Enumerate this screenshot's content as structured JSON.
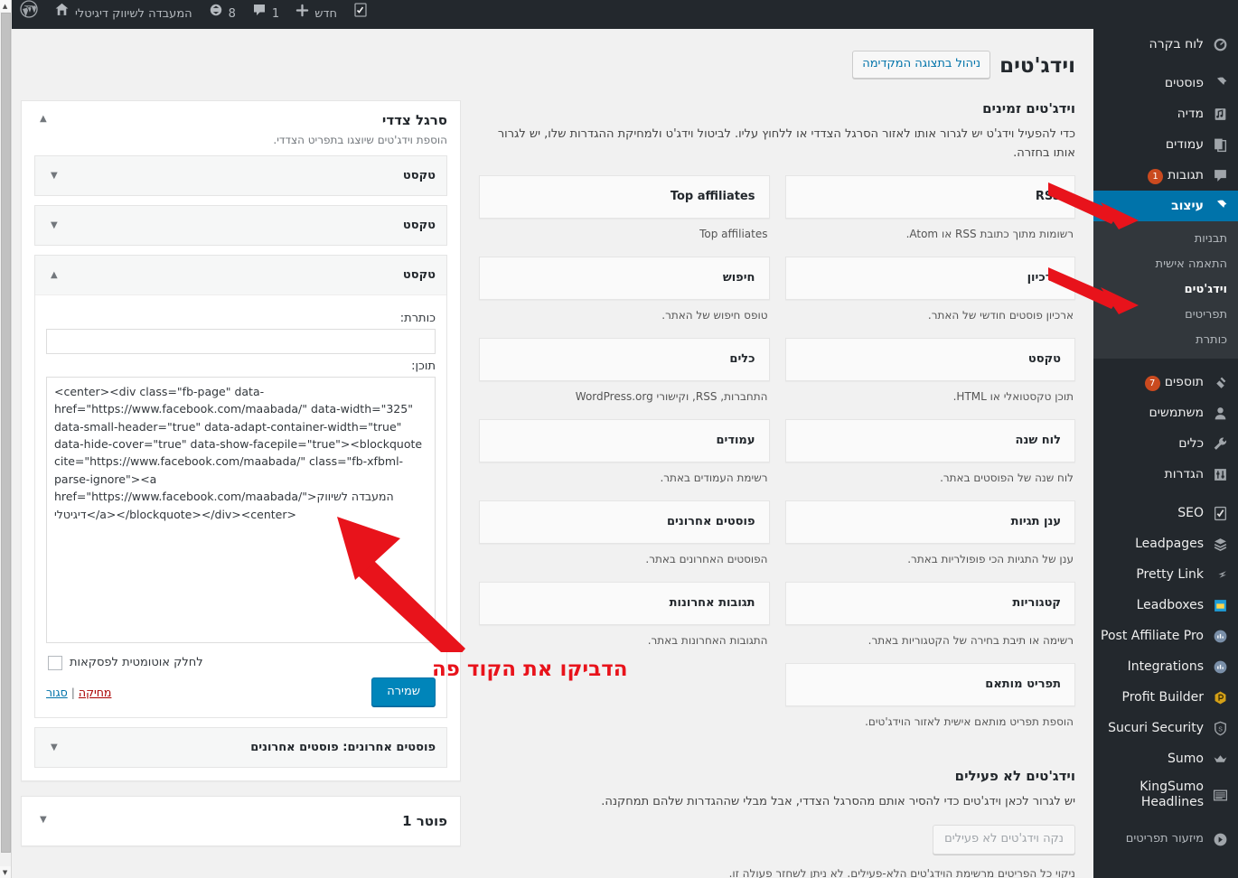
{
  "adminbar": {
    "site_name": "המעבדה לשיווק דיגיטלי",
    "updates_count": "8",
    "comments_count": "1",
    "new_label": "חדש",
    "wp_logo_icon": "wordpress-logo-icon",
    "home_icon": "home-icon",
    "updates_icon": "update-refresh-icon",
    "comments_icon": "comment-bubble-icon",
    "new_icon": "plus-icon",
    "seo_icon": "yoast-seo-icon"
  },
  "sidebar": {
    "items": [
      {
        "label": "לוח בקרה",
        "icon": "dashboard-gauge-icon",
        "badge": "",
        "current": false
      },
      {
        "label": "פוסטים",
        "icon": "pin-icon",
        "badge": "",
        "current": false
      },
      {
        "label": "מדיה",
        "icon": "media-music-icon",
        "badge": "",
        "current": false
      },
      {
        "label": "עמודים",
        "icon": "pages-icon",
        "badge": "",
        "current": false
      },
      {
        "label": "תגובות",
        "icon": "comment-bubble-icon",
        "badge": "1",
        "current": false
      },
      {
        "label": "עיצוב",
        "icon": "appearance-brush-icon",
        "badge": "",
        "current": true
      },
      {
        "label": "תוספים",
        "icon": "plugin-plug-icon",
        "badge": "7",
        "current": false
      },
      {
        "label": "משתמשים",
        "icon": "user-icon",
        "badge": "",
        "current": false
      },
      {
        "label": "כלים",
        "icon": "wrench-tools-icon",
        "badge": "",
        "current": false
      },
      {
        "label": "הגדרות",
        "icon": "settings-sliders-icon",
        "badge": "",
        "current": false
      },
      {
        "label": "SEO",
        "icon": "yoast-seo-icon",
        "badge": "",
        "current": false
      },
      {
        "label": "Leadpages",
        "icon": "layers-icon",
        "badge": "",
        "current": false
      },
      {
        "label": "Pretty Link",
        "icon": "pretty-link-icon",
        "badge": "",
        "current": false
      },
      {
        "label": "Leadboxes",
        "icon": "leadboxes-window-icon",
        "badge": "",
        "current": false
      },
      {
        "label": "Post Affiliate Pro",
        "icon": "affiliate-chart-icon",
        "badge": "",
        "current": false
      },
      {
        "label": "Integrations",
        "icon": "integrations-chart-icon",
        "badge": "",
        "current": false
      },
      {
        "label": "Profit Builder",
        "icon": "profit-builder-hex-icon",
        "badge": "",
        "current": false
      },
      {
        "label": "Sucuri Security",
        "icon": "shield-icon",
        "badge": "",
        "current": false
      },
      {
        "label": "Sumo",
        "icon": "crown-icon",
        "badge": "",
        "current": false
      },
      {
        "label": "KingSumo Headlines",
        "icon": "headlines-lines-icon",
        "badge": "",
        "current": false
      },
      {
        "label": "מיזעור תפריטים",
        "icon": "collapse-arrow-icon",
        "badge": "",
        "current": false
      }
    ],
    "submenu": {
      "after_index": 5,
      "items": [
        {
          "label": "תבניות",
          "current": false
        },
        {
          "label": "התאמה אישית",
          "current": false
        },
        {
          "label": "וידג'טים",
          "current": true
        },
        {
          "label": "תפריטים",
          "current": false
        },
        {
          "label": "כותרת",
          "current": false
        }
      ]
    }
  },
  "main": {
    "page_title": "וידג'טים",
    "title_action": "ניהול בתצוגה המקדימה",
    "available": {
      "heading": "וידג'טים זמינים",
      "description": "כדי להפעיל וידג'ט יש לגרור אותו לאזור הסרגל הצדדי או ללחוץ עליו. לביטול וידג'ט ולמחיקת ההגדרות שלו, יש לגרור אותו בחזרה.",
      "widgets": [
        {
          "name": "RSS",
          "desc": "רשומות מתוך כתובת RSS או Atom."
        },
        {
          "name": "Top affiliates",
          "desc": "Top affiliates"
        },
        {
          "name": "ארכיון",
          "desc": "ארכיון פוסטים חודשי של האתר."
        },
        {
          "name": "חיפוש",
          "desc": "טופס חיפוש של האתר."
        },
        {
          "name": "טקסט",
          "desc": "תוכן טקסטואלי או HTML."
        },
        {
          "name": "כלים",
          "desc": "התחברות, RSS, וקישורי WordPress.org"
        },
        {
          "name": "לוח שנה",
          "desc": "לוח שנה של הפוסטים באתר."
        },
        {
          "name": "עמודים",
          "desc": "רשימת העמודים באתר."
        },
        {
          "name": "ענן תגיות",
          "desc": "ענן של התגיות הכי פופולריות באתר."
        },
        {
          "name": "פוסטים אחרונים",
          "desc": "הפוסטים האחרונים באתר."
        },
        {
          "name": "קטגוריות",
          "desc": "רשימה או תיבת בחירה של הקטגוריות באתר."
        },
        {
          "name": "תגובות אחרונות",
          "desc": "התגובות האחרונות באתר."
        },
        {
          "name": "תפריט מותאם",
          "desc": "הוספת תפריט מותאם אישית לאזור הוידג'טים."
        }
      ]
    },
    "inactive": {
      "heading": "וידג'טים לא פעילים",
      "description": "יש לגרור לכאן וידג'טים כדי להסיר אותם מהסרגל הצדדי, אבל מבלי שההגדרות שלהם תמחקנה.",
      "clear_button": "נקה וידג'טים לא פעילים",
      "note": "ניקוי כל הפריטים מרשימת הוידג'טים הלא-פעילים. לא ניתן לשחזר פעולה זו."
    }
  },
  "sidebars_panel": [
    {
      "title": "סרגל צדדי",
      "desc": "הוספת וידג'טים שיוצגו בתפריט הצדדי.",
      "expanded": true,
      "toggle_icon": "chevron-up-icon",
      "widgets": [
        {
          "title": "טקסט",
          "open": false,
          "toggle_icon": "chevron-down-icon"
        },
        {
          "title": "טקסט",
          "open": false,
          "toggle_icon": "chevron-down-icon"
        },
        {
          "title": "טקסט",
          "open": true,
          "toggle_icon": "chevron-up-icon",
          "form": {
            "title_label": "כותרת:",
            "title_value": "",
            "content_label": "תוכן:",
            "content_value": "<center><div class=\"fb-page\" data-href=\"https://www.facebook.com/maabada/\" data-width=\"325\" data-small-header=\"true\" data-adapt-container-width=\"true\" data-hide-cover=\"true\" data-show-facepile=\"true\"><blockquote cite=\"https://www.facebook.com/maabada/\" class=\"fb-xfbml-parse-ignore\"><a href=\"https://www.facebook.com/maabada/\">המעבדה לשיווק דיגיטלי</a></blockquote></div><center>",
            "autop_label": "לחלק אוטומטית לפסקאות",
            "autop_checked": false,
            "delete_label": "מחיקה",
            "close_label": "סגור",
            "separator": "|",
            "save_label": "שמירה"
          }
        },
        {
          "title": "פוסטים אחרונים: פוסטים אחרונים",
          "open": false,
          "toggle_icon": "chevron-down-icon"
        }
      ]
    },
    {
      "title": "פוטר 1",
      "desc": "",
      "expanded": false,
      "toggle_icon": "chevron-down-icon",
      "widgets": []
    }
  ],
  "annotations": {
    "paste_here_text": "הדביקו את הקוד פה",
    "color": "#e8131b",
    "arrows": [
      {
        "name": "arrow-to-appearance-menu"
      },
      {
        "name": "arrow-to-widgets-submenu"
      },
      {
        "name": "arrow-to-text-widget-code"
      }
    ]
  },
  "colors": {
    "accent": "#0073aa",
    "admin_dark": "#23282d",
    "page_bg": "#f1f1f1",
    "badge": "#ca4a1f",
    "annotation_red": "#e8131b"
  }
}
